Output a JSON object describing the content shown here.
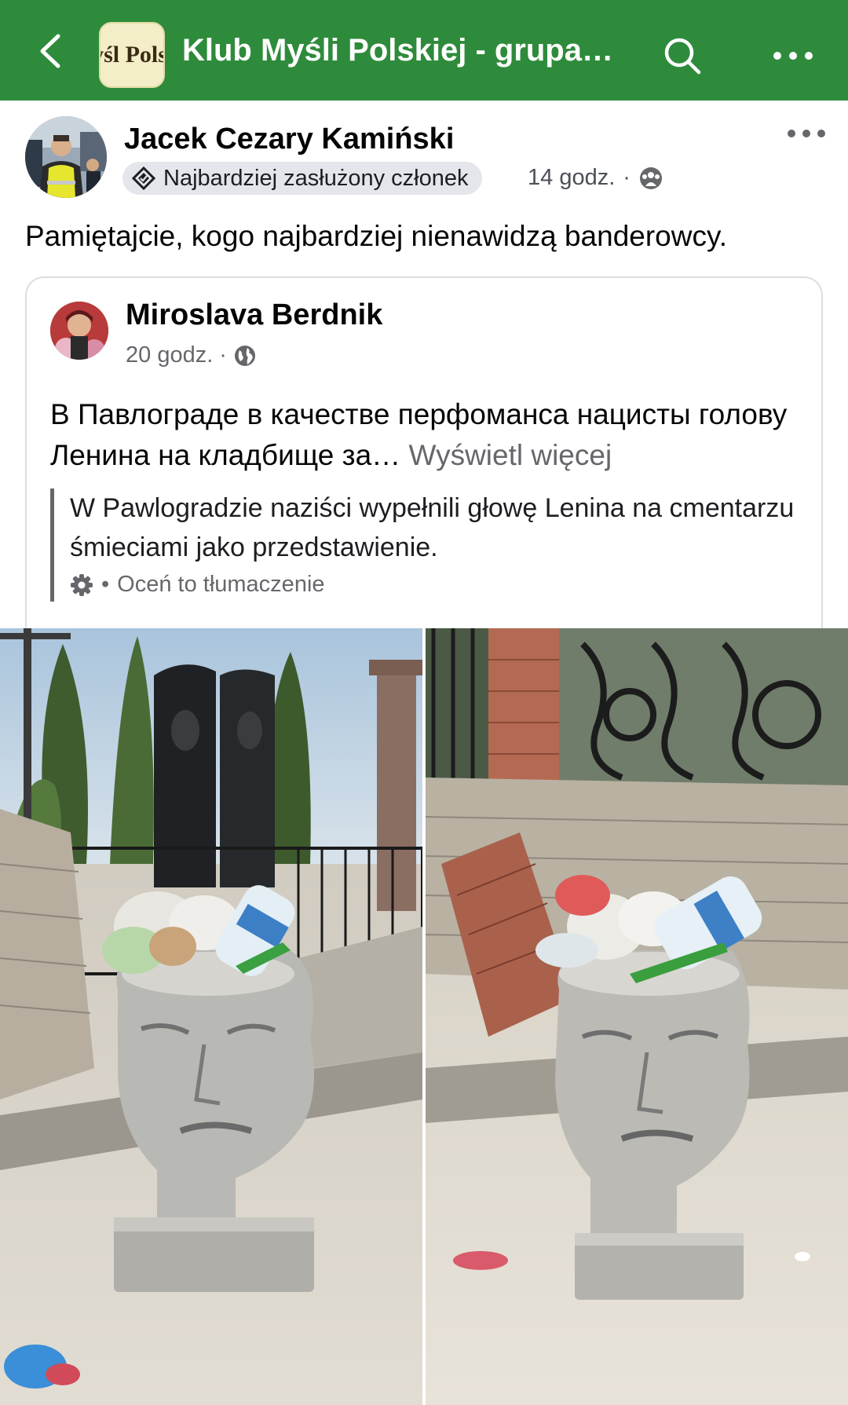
{
  "header": {
    "group_logo_text": "yśl Pols",
    "title": "Klub Myśli Polskiej - grupa…",
    "icons": [
      "back-arrow-icon",
      "search-icon",
      "more-icon"
    ]
  },
  "post": {
    "author": "Jacek Cezary Kamiński",
    "badge": "Najbardziej zasłużony członek",
    "time": "14 godz.",
    "separator": "·",
    "audience_icon": "group-audience-icon",
    "text": "Pamiętajcie, kogo najbardziej nienawidzą banderowcy."
  },
  "shared": {
    "author": "Miroslava Berdnik",
    "time": "20 godz.",
    "separator": "·",
    "audience_icon": "globe-icon",
    "text": "В Павлограде в качестве перфоманса нацисты голову Ленина на кладбище за…",
    "see_more": "Wyświetl więcej",
    "translation": "W Pawlogradzie naziści wypełnili głowę Lenina na cmentarzu śmieciami jako przedstawienie.",
    "translation_separator": "•",
    "rate_translation": "Oceń to tłumaczenie"
  },
  "colors": {
    "header_green": "#2e8b3c",
    "text_primary": "#050505",
    "text_secondary": "#65676b",
    "badge_bg": "#e4e6eb"
  }
}
